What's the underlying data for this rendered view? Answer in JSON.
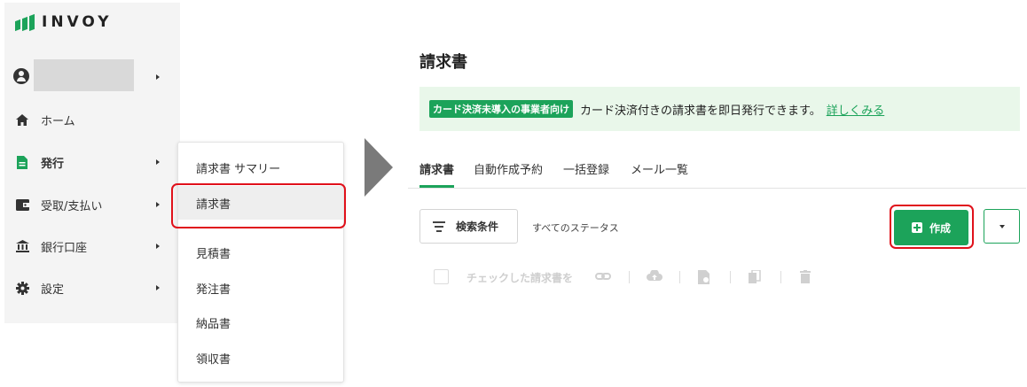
{
  "brand": {
    "name": "INVOY",
    "color": "#1ca35a"
  },
  "sidebar": {
    "items": [
      {
        "label": "ホーム",
        "icon": "home-icon"
      },
      {
        "label": "発行",
        "icon": "document-icon"
      },
      {
        "label": "受取/支払い",
        "icon": "wallet-icon"
      },
      {
        "label": "銀行口座",
        "icon": "bank-icon"
      },
      {
        "label": "設定",
        "icon": "gear-icon"
      }
    ]
  },
  "submenu": {
    "items": [
      {
        "label": "請求書 サマリー"
      },
      {
        "label": "請求書"
      },
      {
        "label": "見積書"
      },
      {
        "label": "発注書"
      },
      {
        "label": "納品書"
      },
      {
        "label": "領収書"
      }
    ],
    "selected": "請求書"
  },
  "main": {
    "title": "請求書",
    "banner": {
      "badge": "カード決済未導入の事業者向け",
      "text": "カード決済付きの請求書を即日発行できます。",
      "link": "詳しくみる"
    },
    "tabs": [
      {
        "label": "請求書"
      },
      {
        "label": "自動作成予約"
      },
      {
        "label": "一括登録"
      },
      {
        "label": "メール一覧"
      }
    ],
    "search_label": "検索条件",
    "status_filter": "すべてのステータス",
    "create_label": "作成",
    "bulk_label": "チェックした請求書を"
  },
  "highlight_color": "#e0111b"
}
